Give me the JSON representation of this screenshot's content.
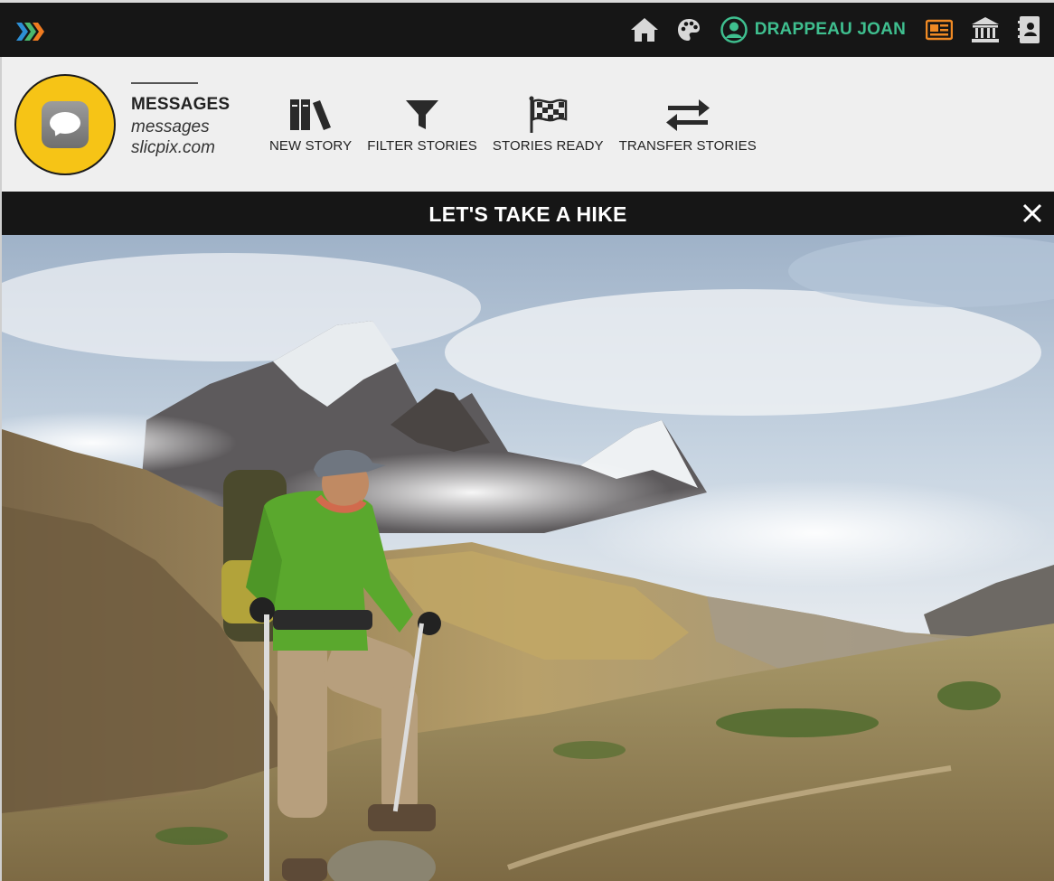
{
  "topbar": {
    "user_name": "DRAPPEAU JOAN",
    "icons": [
      "home-icon",
      "palette-icon",
      "user-circle-icon",
      "news-icon",
      "bank-icon",
      "contacts-icon"
    ],
    "accent_color": "#3fbf8f"
  },
  "account": {
    "title": "MESSAGES",
    "handle": "messages",
    "domain": "slicpix.com",
    "avatar_color": "#f6c416"
  },
  "actions": [
    {
      "label": "NEW STORY",
      "icon": "books-icon"
    },
    {
      "label": "FILTER STORIES",
      "icon": "filter-icon"
    },
    {
      "label": "STORIES READY",
      "icon": "checkered-flag-icon"
    },
    {
      "label": "TRANSFER STORIES",
      "icon": "transfer-arrows-icon"
    }
  ],
  "story": {
    "title": "LET'S TAKE A HIKE",
    "image": "hiker-mountains-photo"
  }
}
